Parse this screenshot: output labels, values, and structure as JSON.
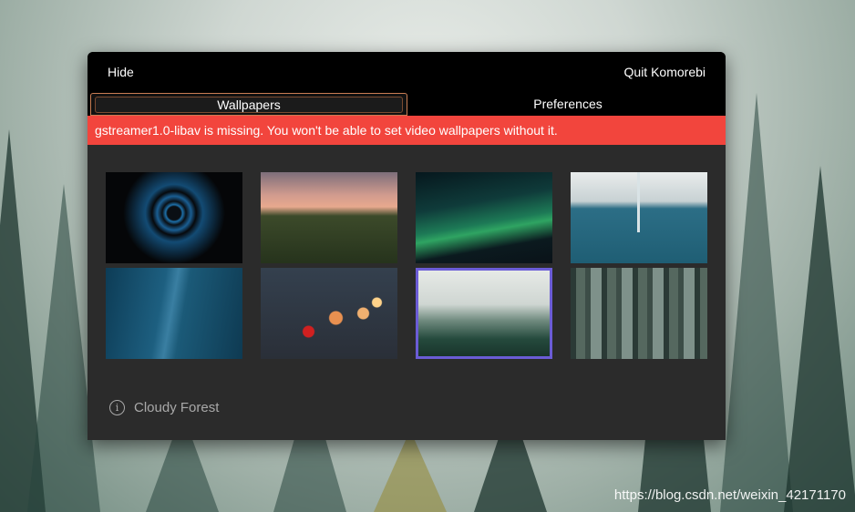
{
  "background": {
    "top_text": "",
    "watermark": "https://blog.csdn.net/weixin_42171170"
  },
  "window": {
    "header": {
      "hide_label": "Hide",
      "quit_label": "Quit Komorebi"
    },
    "tabs": [
      {
        "label": "Wallpapers",
        "active": true
      },
      {
        "label": "Preferences",
        "active": false
      }
    ],
    "banner": {
      "message": "gstreamer1.0-libav is missing. You won't be able to set video wallpapers without it.",
      "color": "#f2453d"
    },
    "wallpapers": [
      {
        "name": "blue-light-swirl",
        "selected": false
      },
      {
        "name": "sunset-hills",
        "selected": false
      },
      {
        "name": "aurora",
        "selected": false
      },
      {
        "name": "aerial-ocean-pier",
        "selected": false
      },
      {
        "name": "blue-waves",
        "selected": false
      },
      {
        "name": "bokeh-lights",
        "selected": false
      },
      {
        "name": "cloudy-forest",
        "selected": true
      },
      {
        "name": "misty-woods",
        "selected": false
      }
    ],
    "selected_caption": "Cloudy Forest",
    "accent_color": "#6b5cd6"
  }
}
